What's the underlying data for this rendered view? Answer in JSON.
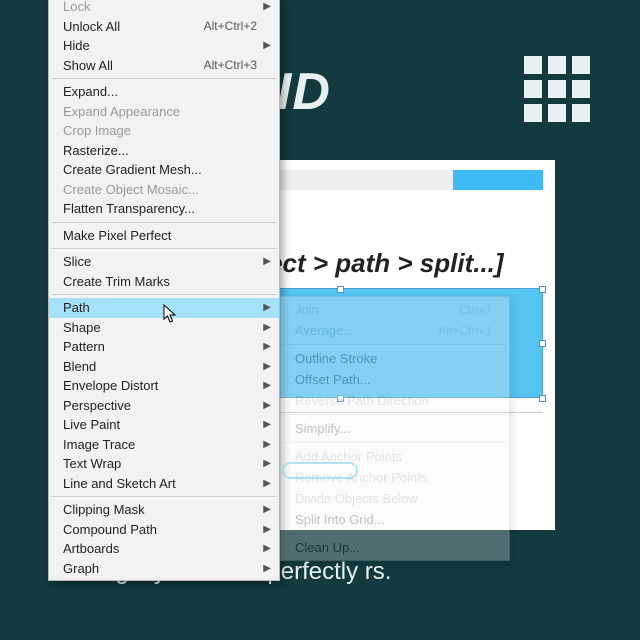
{
  "background": {
    "title": "O GRID",
    "caption_line": "ting layouts with perfectly rs."
  },
  "artboard": {
    "hint": "[object > path > split...]"
  },
  "menu": {
    "sections": [
      [
        {
          "label": "Lock",
          "sub": true,
          "disabled": true
        },
        {
          "label": "Unlock All",
          "shortcut": "Alt+Ctrl+2"
        },
        {
          "label": "Hide",
          "sub": true
        },
        {
          "label": "Show All",
          "shortcut": "Alt+Ctrl+3"
        }
      ],
      [
        {
          "label": "Expand..."
        },
        {
          "label": "Expand Appearance",
          "disabled": true
        },
        {
          "label": "Crop Image",
          "disabled": true
        },
        {
          "label": "Rasterize..."
        },
        {
          "label": "Create Gradient Mesh..."
        },
        {
          "label": "Create Object Mosaic...",
          "disabled": true
        },
        {
          "label": "Flatten Transparency..."
        }
      ],
      [
        {
          "label": "Make Pixel Perfect"
        }
      ],
      [
        {
          "label": "Slice",
          "sub": true
        },
        {
          "label": "Create Trim Marks"
        }
      ],
      [
        {
          "label": "Path",
          "sub": true,
          "selected": true
        },
        {
          "label": "Shape",
          "sub": true
        },
        {
          "label": "Pattern",
          "sub": true
        },
        {
          "label": "Blend",
          "sub": true
        },
        {
          "label": "Envelope Distort",
          "sub": true
        },
        {
          "label": "Perspective",
          "sub": true
        },
        {
          "label": "Live Paint",
          "sub": true
        },
        {
          "label": "Image Trace",
          "sub": true
        },
        {
          "label": "Text Wrap",
          "sub": true
        },
        {
          "label": "Line and Sketch Art",
          "sub": true
        }
      ],
      [
        {
          "label": "Clipping Mask",
          "sub": true
        },
        {
          "label": "Compound Path",
          "sub": true
        },
        {
          "label": "Artboards",
          "sub": true
        },
        {
          "label": "Graph",
          "sub": true
        }
      ]
    ]
  },
  "submenu": {
    "sections": [
      [
        {
          "label": "Join",
          "shortcut": "Ctrl+J",
          "disabled": true
        },
        {
          "label": "Average...",
          "shortcut": "Alt+Ctrl+J",
          "disabled": true
        }
      ],
      [
        {
          "label": "Outline Stroke"
        },
        {
          "label": "Offset Path..."
        },
        {
          "label": "Reverse Path Direction",
          "disabled": true
        }
      ],
      [
        {
          "label": "Simplify..."
        }
      ],
      [
        {
          "label": "Add Anchor Points",
          "disabled": true
        },
        {
          "label": "Remove Anchor Points",
          "disabled": true
        },
        {
          "label": "Divide Objects Below",
          "disabled": true
        },
        {
          "label": "Split Into Grid..."
        }
      ],
      [
        {
          "label": "Clean Up..."
        }
      ]
    ]
  }
}
